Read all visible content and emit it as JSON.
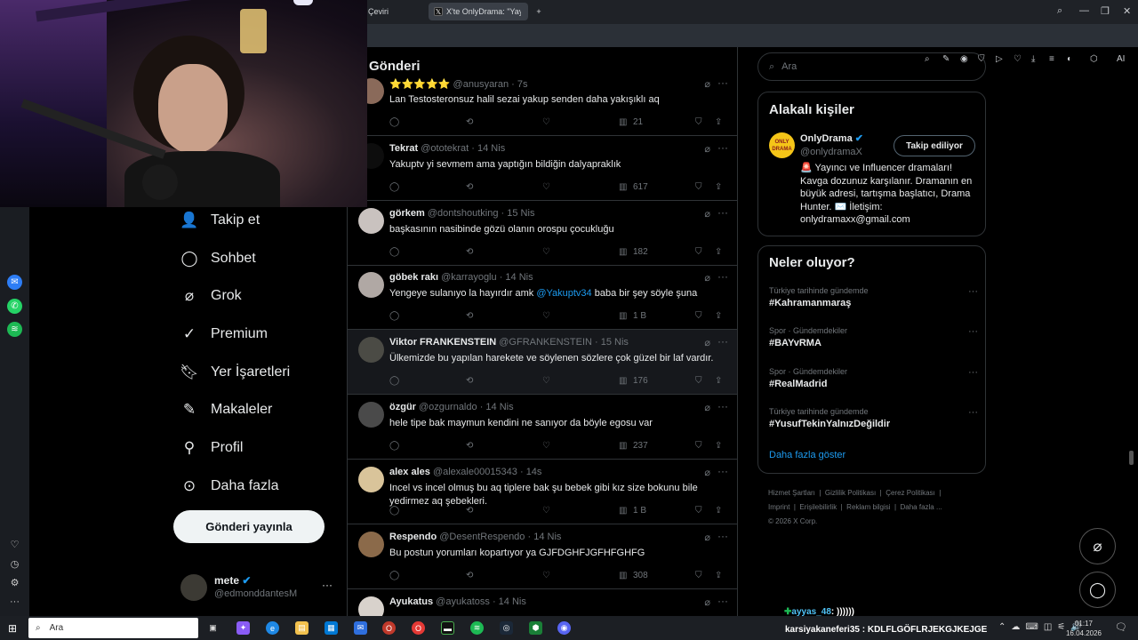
{
  "browser": {
    "tabs": [
      {
        "label": "Çeviri"
      },
      {
        "label": "X'te OnlyDrama: \"Yayıncı ..."
      }
    ],
    "new_tab_icon": "plus-icon",
    "ai_label": "AI"
  },
  "page": {
    "title": "Gönderi"
  },
  "nav": {
    "items": [
      {
        "label": "Takip et",
        "icon": "add-user-icon"
      },
      {
        "label": "Sohbet",
        "icon": "chat-icon"
      },
      {
        "label": "Grok",
        "icon": "grok-icon"
      },
      {
        "label": "Premium",
        "icon": "verified-icon"
      },
      {
        "label": "Yer İşaretleri",
        "icon": "bookmark-icon"
      },
      {
        "label": "Makaleler",
        "icon": "article-icon"
      },
      {
        "label": "Profil",
        "icon": "person-icon"
      },
      {
        "label": "Daha fazla",
        "icon": "more-circle-icon"
      }
    ],
    "post_button": "Gönderi yayınla",
    "account": {
      "name": "mete",
      "handle": "@edmonddantesM",
      "more": "···"
    }
  },
  "feed": {
    "tweets": [
      {
        "name": "⭐⭐⭐⭐⭐",
        "handle": "@anusyaran",
        "time": "· 7s",
        "text": "Lan Testosteronsuz halil sezai yakup senden daha yakışıklı aq",
        "mention": "",
        "text_after": "",
        "views": "21"
      },
      {
        "name": "Tekrat",
        "handle": "@ototekrat",
        "time": "· 14 Nis",
        "text": "Yakuptv yi sevmem ama yaptığın bildiğin dalyapraklık",
        "mention": "",
        "text_after": "",
        "views": "617"
      },
      {
        "name": "görkem",
        "handle": "@dontshoutking",
        "time": "· 15 Nis",
        "text": "başkasının nasibinde gözü olanın orospu çocukluğu",
        "mention": "",
        "text_after": "",
        "views": "182"
      },
      {
        "name": "göbek rakı",
        "handle": "@karrayoglu",
        "time": "· 14 Nis",
        "text": "Yengeye sulanıyo la hayırdır amk ",
        "mention": "@Yakuptv34",
        "text_after": " baba bir şey söyle şuna",
        "views": "1 B"
      },
      {
        "name": "Viktor FRANKENSTEIN",
        "handle": "@GFRANKENSTEIN",
        "time": "· 15 Nis",
        "text": "Ülkemizde bu yapılan harekete ve söylenen sözlere çok güzel bir laf vardır.",
        "mention": "",
        "text_after": "",
        "views": "176"
      },
      {
        "name": "özgür",
        "handle": "@ozgurnaldo",
        "time": "· 14 Nis",
        "text": "hele tipe bak maymun kendini ne sanıyor da böyle egosu var",
        "mention": "",
        "text_after": "",
        "views": "237"
      },
      {
        "name": "alex ales",
        "handle": "@alexale00015343",
        "time": "· 14s",
        "text": "Incel vs incel olmuş bu aq tiplere bak şu bebek gibi kız size bokunu bile yedirmez aq şebekleri.",
        "mention": "",
        "text_after": "",
        "views": "1 B"
      },
      {
        "name": "Respendo",
        "handle": "@DesentRespendo",
        "time": "· 14 Nis",
        "text": "Bu postun yorumları kopartıyor ya GJFDGHFJGFHFGHFG",
        "mention": "",
        "text_after": "",
        "views": "308"
      },
      {
        "name": "Ayukatus",
        "handle": "@ayukatoss",
        "time": "· 14 Nis",
        "text": "",
        "mention": "",
        "text_after": "",
        "views": ""
      }
    ]
  },
  "right": {
    "search_placeholder": "Ara",
    "related": {
      "title": "Alakalı kişiler",
      "name": "OnlyDrama",
      "handle": "@onlydramaX",
      "follow_button": "Takip ediliyor",
      "bio": "🚨 Yayıncı ve Influencer dramaları! Kavga dozunuz karşılanır. Dramanın en büyük adresi, tartışma başlatıcı, Drama Hunter. ✉️ İletişim: onlydramaxx@gmail.com",
      "avatar_text": "ONLY DRAMA"
    },
    "trends": {
      "title": "Neler oluyor?",
      "items": [
        {
          "category": "Türkiye tarihinde gündemde",
          "name": "#Kahramanmaraş"
        },
        {
          "category": "Spor · Gündemdekiler",
          "name": "#BAYvRMA"
        },
        {
          "category": "Spor · Gündemdekiler",
          "name": "#RealMadrid"
        },
        {
          "category": "Türkiye tarihinde gündemde",
          "name": "#YusufTekinYalnızDeğildir"
        }
      ],
      "show_more": "Daha fazla göster"
    },
    "footer": {
      "links": [
        "Hizmet Şartları",
        "Gizlilik Politikası",
        "Çerez Politikası",
        "Imprint",
        "Erişilebilirlik",
        "Reklam bilgisi",
        "Daha fazla ..."
      ],
      "copyright": "© 2026 X Corp."
    }
  },
  "stream_chat": [
    {
      "user": "ayyas_48",
      "message": ": ))))))"
    },
    {
      "user": "karsiyakaneferi35",
      "message": ": KDLFLGÖFLRJEKGJKEJGE"
    }
  ],
  "taskbar": {
    "search_placeholder": "Ara",
    "time": "01:17",
    "date": "16.04.2026"
  },
  "colors": {
    "accent": "#1d9bf0",
    "background": "#000000",
    "border": "#2f3336",
    "muted": "#71767b"
  }
}
